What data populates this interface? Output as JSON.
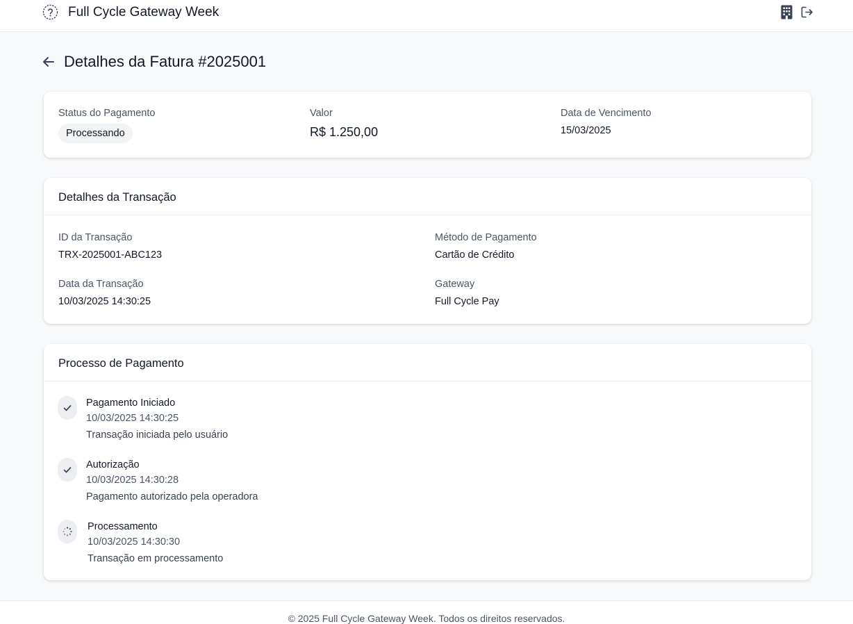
{
  "header": {
    "app_title": "Full Cycle Gateway Week",
    "icons": [
      "help-circle-icon",
      "building-icon",
      "logout-icon"
    ]
  },
  "page": {
    "title": "Detalhes da Fatura #2025001"
  },
  "summary": {
    "status_label": "Status do Pagamento",
    "status_value": "Processando",
    "amount_label": "Valor",
    "amount_value": "R$ 1.250,00",
    "due_label": "Data de Vencimento",
    "due_value": "15/03/2025"
  },
  "transaction": {
    "title": "Detalhes da Transação",
    "fields": [
      {
        "label": "ID da Transação",
        "value": "TRX-2025001-ABC123"
      },
      {
        "label": "Método de Pagamento",
        "value": "Cartão de Crédito"
      },
      {
        "label": "Data da Transação",
        "value": "10/03/2025 14:30:25"
      },
      {
        "label": "Gateway",
        "value": "Full Cycle Pay"
      }
    ]
  },
  "process": {
    "title": "Processo de Pagamento",
    "steps": [
      {
        "title": "Pagamento Iniciado",
        "time": "10/03/2025 14:30:25",
        "description": "Transação iniciada pelo usuário",
        "icon": "check-icon"
      },
      {
        "title": "Autorização",
        "time": "10/03/2025 14:30:28",
        "description": "Pagamento autorizado pela operadora",
        "icon": "check-icon"
      },
      {
        "title": "Processamento",
        "time": "10/03/2025 14:30:30",
        "description": "Transação em processamento",
        "icon": "spinner-icon"
      }
    ]
  },
  "footer": {
    "text": "© 2025 Full Cycle Gateway Week. Todos os direitos reservados."
  },
  "colors": {
    "background": "#f8f9fa",
    "card": "#ffffff",
    "text_primary": "#111827",
    "text_secondary": "#4b5563",
    "badge_bg": "#f3f4f6"
  }
}
